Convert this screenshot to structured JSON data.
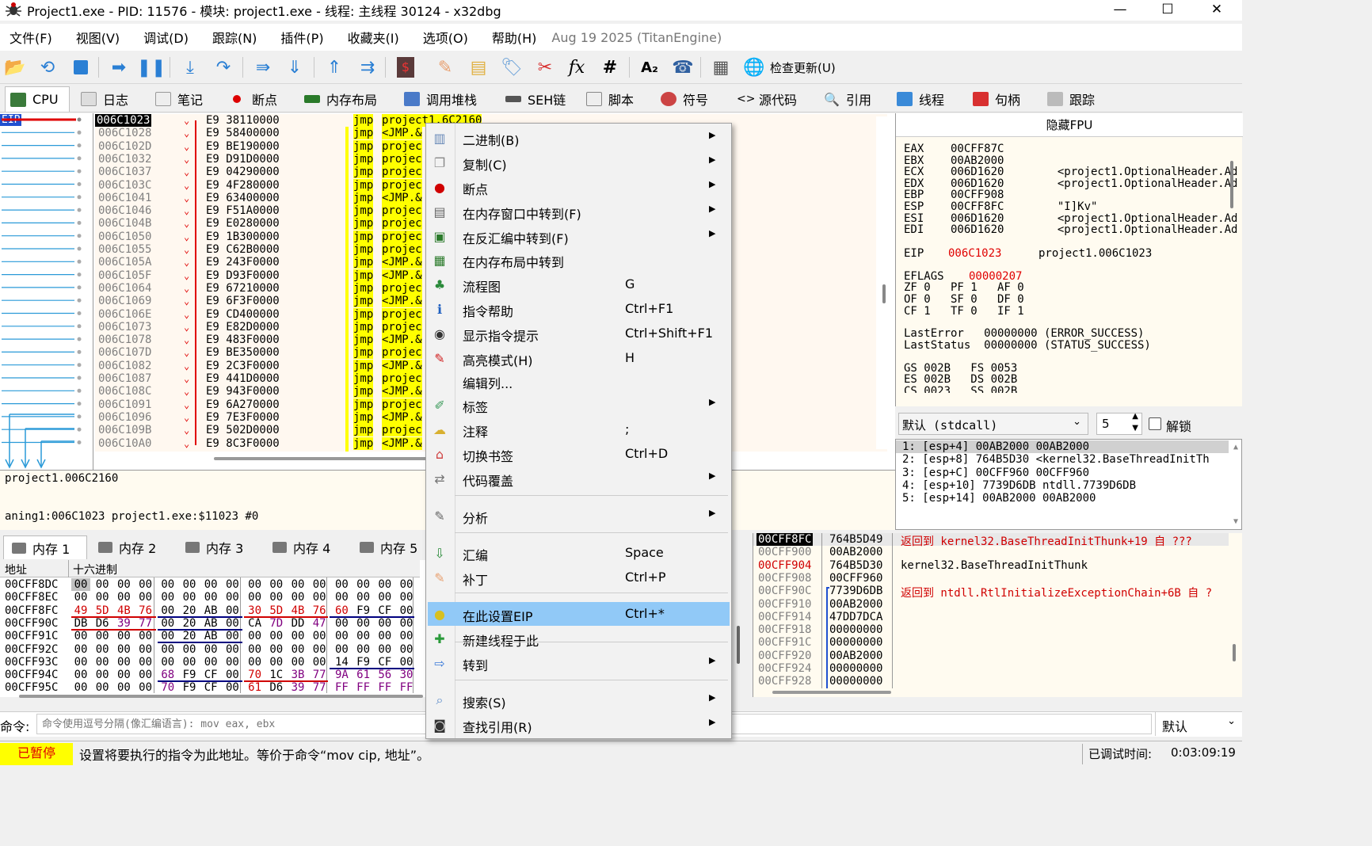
{
  "window": {
    "title": "Project1.exe - PID: 11576 - 模块: project1.exe - 线程: 主线程 30124 - x32dbg"
  },
  "menubar": {
    "items": [
      "文件(F)",
      "视图(V)",
      "调试(D)",
      "跟踪(N)",
      "插件(P)",
      "收藏夹(I)",
      "选项(O)",
      "帮助(H)"
    ],
    "date": "Aug 19 2025 (TitanEngine)"
  },
  "toolbar": {
    "check_updates": "检查更新(U)"
  },
  "tabs": [
    "CPU",
    "日志",
    "笔记",
    "断点",
    "内存布局",
    "调用堆栈",
    "SEH链",
    "脚本",
    "符号",
    "源代码",
    "引用",
    "线程",
    "句柄",
    "跟踪"
  ],
  "disasm": {
    "eip_label": "EIP",
    "rows": [
      {
        "addr": "006C1023",
        "bytes": "E9 38110000",
        "mnem": "jmp",
        "op": "project1.6C2160"
      },
      {
        "addr": "006C1028",
        "bytes": "E9 58400000",
        "mnem": "jmp",
        "op": "<JMP.&"
      },
      {
        "addr": "006C102D",
        "bytes": "E9 BE190000",
        "mnem": "jmp",
        "op": "projec"
      },
      {
        "addr": "006C1032",
        "bytes": "E9 D91D0000",
        "mnem": "jmp",
        "op": "projec"
      },
      {
        "addr": "006C1037",
        "bytes": "E9 04290000",
        "mnem": "jmp",
        "op": "projec"
      },
      {
        "addr": "006C103C",
        "bytes": "E9 4F280000",
        "mnem": "jmp",
        "op": "projec"
      },
      {
        "addr": "006C1041",
        "bytes": "E9 63400000",
        "mnem": "jmp",
        "op": "<JMP.&"
      },
      {
        "addr": "006C1046",
        "bytes": "E9 F51A0000",
        "mnem": "jmp",
        "op": "projec"
      },
      {
        "addr": "006C104B",
        "bytes": "E9 E0280000",
        "mnem": "jmp",
        "op": "projec"
      },
      {
        "addr": "006C1050",
        "bytes": "E9 1B300000",
        "mnem": "jmp",
        "op": "projec"
      },
      {
        "addr": "006C1055",
        "bytes": "E9 C62B0000",
        "mnem": "jmp",
        "op": "projec"
      },
      {
        "addr": "006C105A",
        "bytes": "E9 243F0000",
        "mnem": "jmp",
        "op": "<JMP.&"
      },
      {
        "addr": "006C105F",
        "bytes": "E9 D93F0000",
        "mnem": "jmp",
        "op": "<JMP.&"
      },
      {
        "addr": "006C1064",
        "bytes": "E9 67210000",
        "mnem": "jmp",
        "op": "projec"
      },
      {
        "addr": "006C1069",
        "bytes": "E9 6F3F0000",
        "mnem": "jmp",
        "op": "<JMP.&"
      },
      {
        "addr": "006C106E",
        "bytes": "E9 CD400000",
        "mnem": "jmp",
        "op": "projec"
      },
      {
        "addr": "006C1073",
        "bytes": "E9 E82D0000",
        "mnem": "jmp",
        "op": "projec"
      },
      {
        "addr": "006C1078",
        "bytes": "E9 483F0000",
        "mnem": "jmp",
        "op": "<JMP.&"
      },
      {
        "addr": "006C107D",
        "bytes": "E9 BE350000",
        "mnem": "jmp",
        "op": "projec"
      },
      {
        "addr": "006C1082",
        "bytes": "E9 2C3F0000",
        "mnem": "jmp",
        "op": "<JMP.&"
      },
      {
        "addr": "006C1087",
        "bytes": "E9 441D0000",
        "mnem": "jmp",
        "op": "projec"
      },
      {
        "addr": "006C108C",
        "bytes": "E9 943F0000",
        "mnem": "jmp",
        "op": "<JMP.&"
      },
      {
        "addr": "006C1091",
        "bytes": "E9 6A270000",
        "mnem": "jmp",
        "op": "projec"
      },
      {
        "addr": "006C1096",
        "bytes": "E9 7E3F0000",
        "mnem": "jmp",
        "op": "<JMP.&"
      },
      {
        "addr": "006C109B",
        "bytes": "E9 502D0000",
        "mnem": "jmp",
        "op": "projec"
      },
      {
        "addr": "006C10A0",
        "bytes": "E9 8C3F0000",
        "mnem": "jmp",
        "op": "<JMP.&"
      }
    ]
  },
  "info": {
    "line1": "project1.006C2160",
    "line2": "aning1:006C1023 project1.exe:$11023 #0"
  },
  "registers": {
    "header": "隐藏FPU",
    "lines": [
      "EAX    00CFF87C",
      "EBX    00AB2000",
      "ECX    006D1620        <project1.OptionalHeader.Ad",
      "EDX    006D1620        <project1.OptionalHeader.Ad",
      "EBP    00CFF908",
      "ESP    00CFF8FC        \"I]Kv\"",
      "ESI    006D1620        <project1.OptionalHeader.Ad",
      "EDI    006D1620        <project1.OptionalHeader.Ad"
    ],
    "eip_name": "EIP",
    "eip_value": "006C1023",
    "eip_comment": "project1.006C1023",
    "eflags_name": "EFLAGS",
    "eflags_value": "00000207",
    "flags": [
      "ZF 0   PF 1   AF 0",
      "OF 0   SF 0   DF 0",
      "CF 1   TF 0   IF 1"
    ],
    "lasterror": "LastError   00000000 (ERROR_SUCCESS)",
    "laststatus": "LastStatus  00000000 (STATUS_SUCCESS)",
    "segs": [
      "GS 002B   FS 0053",
      "ES 002B   DS 002B",
      "CS 0023   SS 002B"
    ]
  },
  "callconv": {
    "selected": "默认 (stdcall)",
    "count": "5",
    "unlock": "解锁"
  },
  "stackargs": [
    "1: [esp+4] 00AB2000 00AB2000",
    "2: [esp+8] 764B5D30 <kernel32.BaseThreadInitTh",
    "3: [esp+C] 00CFF960 00CFF960",
    "4: [esp+10] 7739D6DB ntdll.7739D6DB",
    "5: [esp+14] 00AB2000 00AB2000"
  ],
  "dump": {
    "tabs": [
      "内存 1",
      "内存 2",
      "内存 3",
      "内存 4",
      "内存 5"
    ],
    "col_addr": "地址",
    "col_hex": "十六进制",
    "rows": [
      {
        "addr": "00CFF8DC",
        "bytes": [
          "00",
          "00",
          "00",
          "00",
          "00",
          "00",
          "00",
          "00",
          "00",
          "00",
          "00",
          "00",
          "00",
          "00",
          "00",
          "00"
        ]
      },
      {
        "addr": "00CFF8EC",
        "bytes": [
          "00",
          "00",
          "00",
          "00",
          "00",
          "00",
          "00",
          "00",
          "00",
          "00",
          "00",
          "00",
          "00",
          "00",
          "00",
          "00"
        ]
      },
      {
        "addr": "00CFF8FC",
        "bytes": [
          "49",
          "5D",
          "4B",
          "76",
          "00",
          "20",
          "AB",
          "00",
          "30",
          "5D",
          "4B",
          "76",
          "60",
          "F9",
          "CF",
          "00"
        ]
      },
      {
        "addr": "00CFF90C",
        "bytes": [
          "DB",
          "D6",
          "39",
          "77",
          "00",
          "20",
          "AB",
          "00",
          "CA",
          "7D",
          "DD",
          "47",
          "00",
          "00",
          "00",
          "00"
        ]
      },
      {
        "addr": "00CFF91C",
        "bytes": [
          "00",
          "00",
          "00",
          "00",
          "00",
          "20",
          "AB",
          "00",
          "00",
          "00",
          "00",
          "00",
          "00",
          "00",
          "00",
          "00"
        ]
      },
      {
        "addr": "00CFF92C",
        "bytes": [
          "00",
          "00",
          "00",
          "00",
          "00",
          "00",
          "00",
          "00",
          "00",
          "00",
          "00",
          "00",
          "00",
          "00",
          "00",
          "00"
        ]
      },
      {
        "addr": "00CFF93C",
        "bytes": [
          "00",
          "00",
          "00",
          "00",
          "00",
          "00",
          "00",
          "00",
          "00",
          "00",
          "00",
          "00",
          "14",
          "F9",
          "CF",
          "00"
        ]
      },
      {
        "addr": "00CFF94C",
        "bytes": [
          "00",
          "00",
          "00",
          "00",
          "68",
          "F9",
          "CF",
          "00",
          "70",
          "1C",
          "3B",
          "77",
          "9A",
          "61",
          "56",
          "30"
        ]
      },
      {
        "addr": "00CFF95C",
        "bytes": [
          "00",
          "00",
          "00",
          "00",
          "70",
          "F9",
          "CF",
          "00",
          "61",
          "D6",
          "39",
          "77",
          "FF",
          "FF",
          "FF",
          "FF"
        ]
      }
    ]
  },
  "stack": [
    {
      "addr": "00CFF8FC",
      "val": "764B5D49",
      "cmt": "返回到 kernel32.BaseThreadInitThunk+19 自 ???"
    },
    {
      "addr": "00CFF900",
      "val": "00AB2000",
      "cmt": ""
    },
    {
      "addr": "00CFF904",
      "val": "764B5D30",
      "cmt": "kernel32.BaseThreadInitThunk"
    },
    {
      "addr": "00CFF908",
      "val": "00CFF960",
      "cmt": ""
    },
    {
      "addr": "00CFF90C",
      "val": "7739D6DB",
      "cmt": "返回到 ntdll.RtlInitializeExceptionChain+6B 自 ?"
    },
    {
      "addr": "00CFF910",
      "val": "00AB2000",
      "cmt": ""
    },
    {
      "addr": "00CFF914",
      "val": "47DD7DCA",
      "cmt": ""
    },
    {
      "addr": "00CFF918",
      "val": "00000000",
      "cmt": ""
    },
    {
      "addr": "00CFF91C",
      "val": "00000000",
      "cmt": ""
    },
    {
      "addr": "00CFF920",
      "val": "00AB2000",
      "cmt": ""
    },
    {
      "addr": "00CFF924",
      "val": "00000000",
      "cmt": ""
    },
    {
      "addr": "00CFF928",
      "val": "00000000",
      "cmt": ""
    }
  ],
  "command": {
    "label": "命令:",
    "placeholder": "命令使用逗号分隔(像汇编语言): mov eax, ebx",
    "default": "默认"
  },
  "status": {
    "state": "已暂停",
    "message": "设置将要执行的指令为此地址。等价于命令“mov cip, 地址”。",
    "time_label": "已调试时间:",
    "time": "0:03:09:19"
  },
  "context_menu": {
    "items": [
      {
        "label": "二进制(B)",
        "key": "",
        "sub": true,
        "icon": "binary-icon"
      },
      {
        "label": "复制(C)",
        "key": "",
        "sub": true,
        "icon": "copy-icon"
      },
      {
        "label": "断点",
        "key": "",
        "sub": true,
        "icon": "breakpoint-icon"
      },
      {
        "label": "在内存窗口中转到(F)",
        "key": "",
        "sub": true,
        "icon": "memory-icon"
      },
      {
        "label": "在反汇编中转到(F)",
        "key": "",
        "sub": true,
        "icon": "cpu-icon"
      },
      {
        "label": "在内存布局中转到",
        "key": "",
        "sub": false,
        "icon": "memory-map-icon"
      },
      {
        "label": "流程图",
        "key": "G",
        "sub": false,
        "icon": "graph-icon"
      },
      {
        "label": "指令帮助",
        "key": "Ctrl+F1",
        "sub": false,
        "icon": "help-icon"
      },
      {
        "label": "显示指令提示",
        "key": "Ctrl+Shift+F1",
        "sub": false,
        "icon": "hint-icon"
      },
      {
        "label": "高亮模式(H)",
        "key": "H",
        "sub": false,
        "icon": "highlight-icon"
      },
      {
        "label": "编辑列...",
        "key": "",
        "sub": false,
        "icon": ""
      },
      {
        "label": "标签",
        "key": "",
        "sub": true,
        "icon": "label-icon"
      },
      {
        "label": "注释",
        "key": ";",
        "sub": false,
        "icon": "comment-icon"
      },
      {
        "label": "切换书签",
        "key": "Ctrl+D",
        "sub": false,
        "icon": "bookmark-icon"
      },
      {
        "label": "代码覆盖",
        "key": "",
        "sub": true,
        "icon": "coverage-icon"
      },
      {
        "label": "分析",
        "key": "",
        "sub": true,
        "icon": "analyze-icon"
      },
      {
        "label": "汇编",
        "key": "Space",
        "sub": false,
        "icon": "assemble-icon"
      },
      {
        "label": "补丁",
        "key": "Ctrl+P",
        "sub": false,
        "icon": "patch-icon"
      },
      {
        "label": "在此设置EIP",
        "key": "Ctrl+*",
        "sub": false,
        "icon": "set-eip-icon"
      },
      {
        "label": "新建线程于此",
        "key": "",
        "sub": false,
        "icon": "new-thread-icon"
      },
      {
        "label": "转到",
        "key": "",
        "sub": true,
        "icon": "goto-icon"
      },
      {
        "label": "搜索(S)",
        "key": "",
        "sub": true,
        "icon": "search-icon"
      },
      {
        "label": "查找引用(R)",
        "key": "",
        "sub": true,
        "icon": "find-references-icon"
      }
    ]
  }
}
